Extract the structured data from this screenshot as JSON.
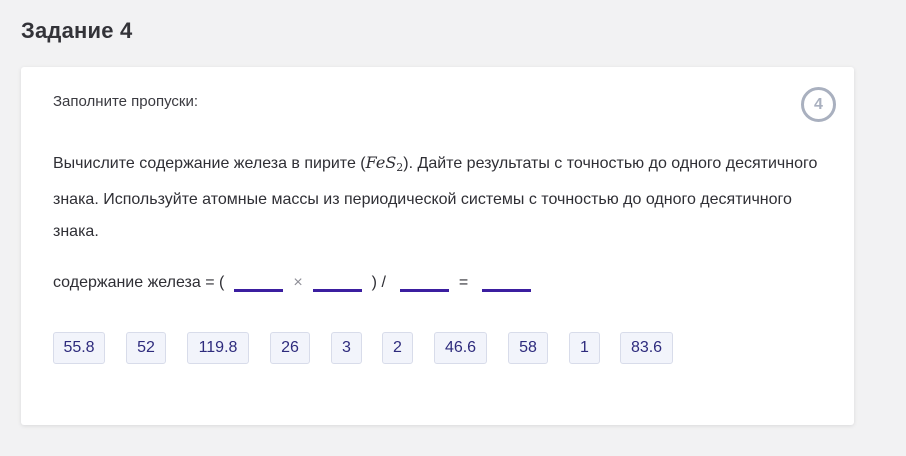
{
  "page": {
    "title": "Задание 4"
  },
  "card": {
    "instruction": "Заполните пропуски:",
    "badge": "4",
    "question": {
      "part1": "Вычислите содержание железа в пирите (",
      "formula_main": "FeS",
      "formula_sub": "2",
      "part2": "). Дайте результаты с точностью до одного десятичного знака. Используйте атомные массы из периодической системы с точностью до одного десятичного знака."
    },
    "equation": {
      "lead": "содержание железа = (",
      "times": "×",
      "close_div": ") /",
      "equals": "="
    },
    "options": [
      "55.8",
      "52",
      "119.8",
      "26",
      "3",
      "2",
      "46.6",
      "58",
      "1",
      "83.6"
    ]
  }
}
